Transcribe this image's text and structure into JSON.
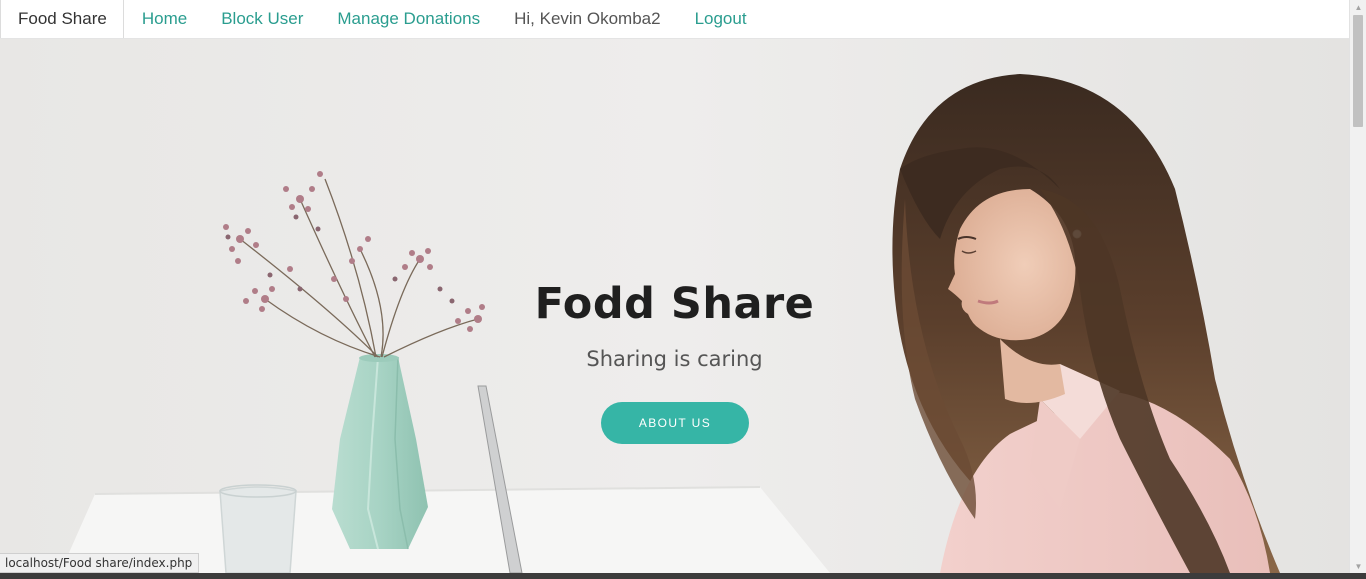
{
  "navbar": {
    "brand": "Food Share",
    "items": [
      {
        "label": "Home"
      },
      {
        "label": "Block User"
      },
      {
        "label": "Manage Donations"
      }
    ],
    "greeting": "Hi, Kevin Okomba2",
    "logout": "Logout"
  },
  "hero": {
    "title": "Fodd Share",
    "subtitle": "Sharing is caring",
    "cta_label": "ABOUT US"
  },
  "status_bar": {
    "url": "localhost/Food share/index.php"
  },
  "colors": {
    "accent": "#36b5a6",
    "link": "#2a9d8f"
  }
}
